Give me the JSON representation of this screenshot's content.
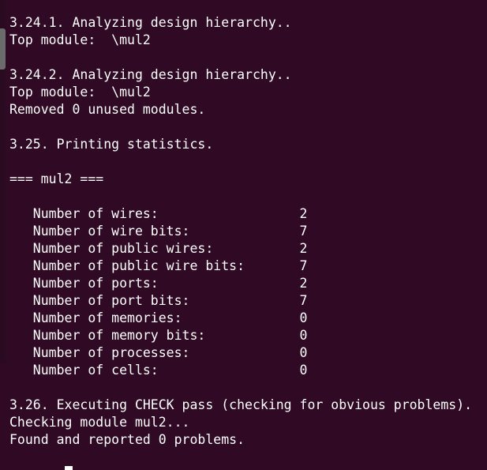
{
  "terminal": {
    "lines": [
      "3.24.1. Analyzing design hierarchy..",
      "Top module:  \\mul2",
      "",
      "3.24.2. Analyzing design hierarchy..",
      "Top module:  \\mul2",
      "Removed 0 unused modules.",
      "",
      "3.25. Printing statistics.",
      "",
      "=== mul2 ===",
      "",
      "   Number of wires:                  2",
      "   Number of wire bits:              7",
      "   Number of public wires:           2",
      "   Number of public wire bits:       7",
      "   Number of ports:                  2",
      "   Number of port bits:              7",
      "   Number of memories:               0",
      "   Number of memory bits:            0",
      "   Number of processes:              0",
      "   Number of cells:                  0",
      "",
      "3.26. Executing CHECK pass (checking for obvious problems).",
      "Checking module mul2...",
      "Found and reported 0 problems."
    ]
  },
  "colors": {
    "background": "#300a24",
    "text": "#ffffff"
  }
}
